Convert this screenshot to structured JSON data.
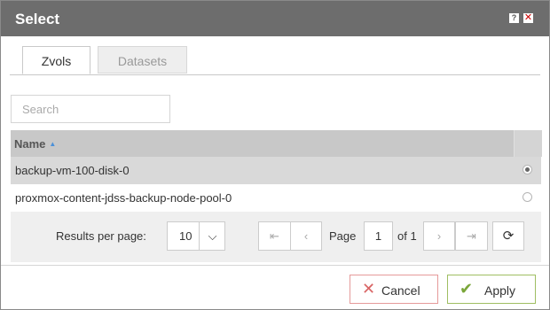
{
  "dialog": {
    "title": "Select",
    "help_icon": "?",
    "close_icon": "✕"
  },
  "tabs": [
    {
      "label": "Zvols",
      "active": true
    },
    {
      "label": "Datasets",
      "active": false
    }
  ],
  "search": {
    "placeholder": "Search",
    "value": ""
  },
  "grid": {
    "columns": [
      {
        "label": "Name",
        "sort": "ascending"
      }
    ],
    "sort_icon": "▲",
    "rows": [
      {
        "name": "backup-vm-100-disk-0",
        "selected": true
      },
      {
        "name": "proxmox-content-jdss-backup-node-pool-0",
        "selected": false
      }
    ]
  },
  "pager": {
    "results_per_page_label": "Results per page:",
    "results_per_page_value": "10",
    "dropdown_icon": "⌵",
    "first_icon": "⇤",
    "prev_icon": "‹",
    "page_label": "Page",
    "page_value": "1",
    "of_label": "of 1",
    "next_icon": "›",
    "last_icon": "⇥",
    "refresh_icon": "⟳"
  },
  "footer": {
    "cancel_label": "Cancel",
    "cancel_icon": "✕",
    "apply_label": "Apply",
    "apply_icon": "✔"
  },
  "colors": {
    "titlebar": "#6d6d6d",
    "header": "#c8c8c8",
    "selected_row": "#d9d9d9",
    "cancel_border": "#e59a9a",
    "apply_border": "#9fbe62"
  }
}
